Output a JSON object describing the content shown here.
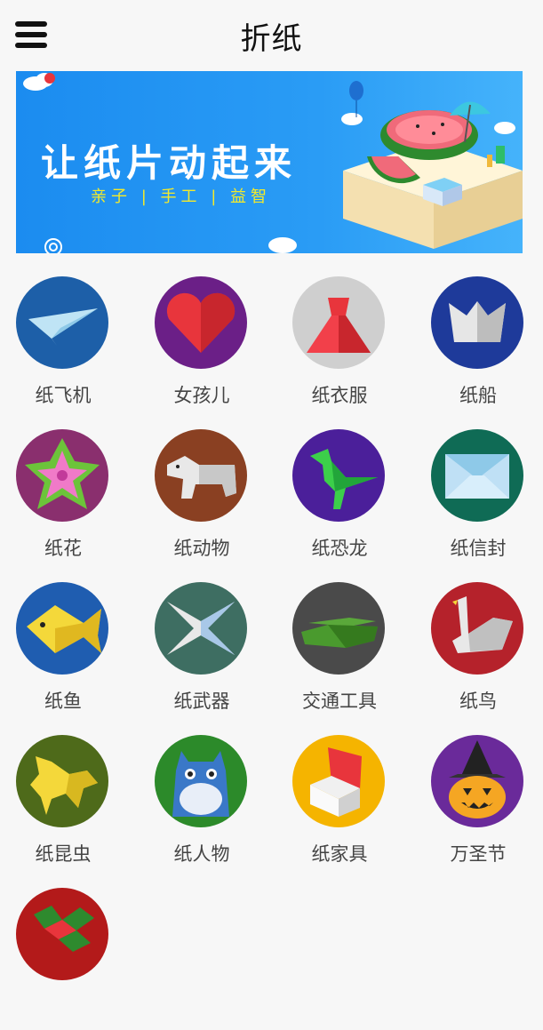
{
  "header": {
    "title": "折纸",
    "menu_icon": "hamburger-menu-icon"
  },
  "banner": {
    "headline": "让纸片动起来",
    "tagline": "亲子 | 手工 | 益智",
    "colors": {
      "background": "#1b8cf0",
      "headline": "#ffffff",
      "tagline": "#f4ea2a"
    }
  },
  "categories": [
    {
      "label": "纸飞机",
      "icon": "paper-plane-icon",
      "bg": "#1d5fa8"
    },
    {
      "label": "女孩儿",
      "icon": "heart-icon",
      "bg": "#6b1f87"
    },
    {
      "label": "纸衣服",
      "icon": "dress-icon",
      "bg": "#cfcfcf"
    },
    {
      "label": "纸船",
      "icon": "boat-icon",
      "bg": "#1e3a9a"
    },
    {
      "label": "纸花",
      "icon": "flower-icon",
      "bg": "#8a2f6e"
    },
    {
      "label": "纸动物",
      "icon": "bear-icon",
      "bg": "#8a4022"
    },
    {
      "label": "纸恐龙",
      "icon": "dinosaur-icon",
      "bg": "#4b1f9a"
    },
    {
      "label": "纸信封",
      "icon": "envelope-icon",
      "bg": "#0f6b55"
    },
    {
      "label": "纸鱼",
      "icon": "fish-icon",
      "bg": "#1f5db0"
    },
    {
      "label": "纸武器",
      "icon": "shuriken-icon",
      "bg": "#3e6e62"
    },
    {
      "label": "交通工具",
      "icon": "tank-icon",
      "bg": "#4a4a4a"
    },
    {
      "label": "纸鸟",
      "icon": "swan-icon",
      "bg": "#b5222b"
    },
    {
      "label": "纸昆虫",
      "icon": "frog-insect-icon",
      "bg": "#4e6a1a"
    },
    {
      "label": "纸人物",
      "icon": "totoro-icon",
      "bg": "#2c8a2a"
    },
    {
      "label": "纸家具",
      "icon": "chair-icon",
      "bg": "#f5b400"
    },
    {
      "label": "万圣节",
      "icon": "pumpkin-icon",
      "bg": "#6a2a9a"
    },
    {
      "label": "",
      "icon": "geometric-pattern-icon",
      "bg": "#b31a1a"
    }
  ]
}
